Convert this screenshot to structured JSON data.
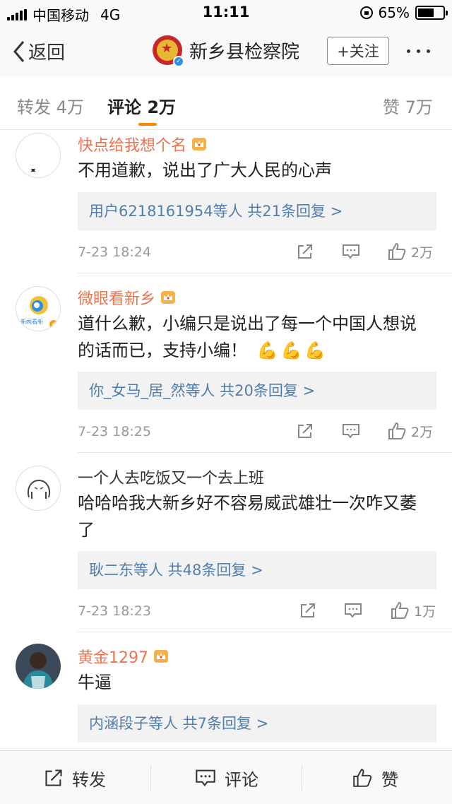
{
  "status_bar": {
    "carrier": "中国移动",
    "network": "4G",
    "time": "11:11",
    "battery": "65%",
    "battery_level": 0.65
  },
  "nav": {
    "back_label": "返回",
    "title": "新乡县检察院",
    "follow_label": "+关注"
  },
  "tabs": [
    {
      "label": "转发 4万"
    },
    {
      "label": "评论 2万"
    },
    {
      "label": "赞 7万"
    }
  ],
  "comments": [
    {
      "name": "快点给我想个名",
      "text": "不用道歉，说出了广大人民的心声",
      "replies": "用户6218161954等人  共21条回复 >",
      "time": "7-23 18:24",
      "likes": "2万"
    },
    {
      "name": "微眼看新乡",
      "avatar_text": "新闻看新",
      "text": "道什么歉，小编只是说出了每一个中国人想说的话而已，支持小编！",
      "emoji": "💪💪💪",
      "replies": "你_女马_居_然等人  共20条回复 >",
      "time": "7-23 18:25",
      "likes": "2万"
    },
    {
      "name": "一个人去吃饭又一个去上班",
      "text": "哈哈哈我大新乡好不容易威武雄壮一次咋又萎了",
      "replies": "耿二东等人  共48条回复 >",
      "time": "7-23 18:23",
      "likes": "1万"
    },
    {
      "name": "黄金1297",
      "text": "牛逼",
      "replies": "内涵段子等人  共7条回复 >"
    }
  ],
  "bottom_bar": {
    "repost_label": "转发",
    "comment_label": "评论",
    "like_label": "赞"
  },
  "colors": {
    "accent": "#ff8200",
    "username": "#eb7350",
    "link": "#507daf"
  }
}
